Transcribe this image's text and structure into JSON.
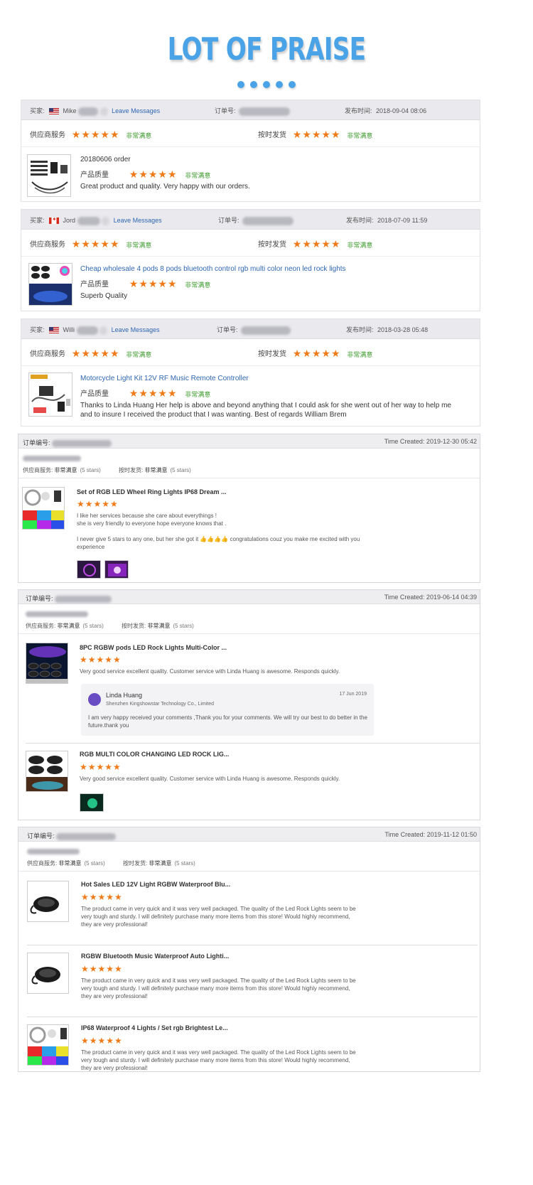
{
  "header": {
    "title": "LOT OF PRAISE",
    "dots_count": 5
  },
  "colors": {
    "accent": "#4aa3e6",
    "star": "#ef7a18",
    "satisfied": "#3c9a2c",
    "link": "#2f67b1"
  },
  "common": {
    "buyer_label": "买家:",
    "order_label": "订单号:",
    "posted_label": "发布时间:",
    "leave_messages": "Leave Messages",
    "service_label": "供应商服务",
    "delivery_label": "按时发货",
    "quality_label": "产品质量",
    "very_satisfied": "非常满意",
    "stars": "★★★★★",
    "order_no_label": "订单编号:",
    "service_label_b": "供应商服务:",
    "delivery_label_b": "按时发货:",
    "five_stars": "(5 stars)"
  },
  "reviews_a": [
    {
      "buyer": "Mike",
      "flag": "us",
      "posted": "2018-09-04 08:06",
      "product_title": "20180606 order",
      "text": "Great product and quality. Very happy with our orders."
    },
    {
      "buyer": "Jord",
      "flag": "ca",
      "posted": "2018-07-09 11:59",
      "product_title": "Cheap wholesale 4 pods 8 pods bluetooth control rgb multi color neon led rock lights",
      "text": "Superb Quality"
    },
    {
      "buyer": "Willi",
      "flag": "us",
      "posted": "2018-03-28 05:48",
      "product_title": "Motorcycle Light Kit 12V RF Music Remote Controller",
      "text": "Thanks to Linda Huang Her help is above and beyond anything that I could ask for she went out of her way to help me and to insure I received the product that I was wanting. Best of regards William Brem"
    }
  ],
  "reviews_b": [
    {
      "time_created": "Time Created: 2019-12-30 05:42",
      "items": [
        {
          "name": "Set of RGB LED Wheel Ring Lights IP68 Dream ...",
          "text1": "I like her services because she care about everythings !",
          "text2": "she is very friendly to everyone hope everyone knows that .",
          "text3": "I never give 5 stars to any one, but her she  got it 👍👍👍👍 congratulations  couz you make me excited with you experience"
        }
      ]
    },
    {
      "time_created": "Time Created: 2019-06-14 04:39",
      "items": [
        {
          "name": "8PC RGBW pods LED Rock Lights Multi-Color ...",
          "text": "Very good service excellent quality. Customer service with Linda Huang is awesome.  Responds quickly.",
          "reply": {
            "name": "Linda Huang",
            "company": "Shenzhen Kingshowstar Technology Co., Limited",
            "date": "17 Jun 2019",
            "text": "I am very happy received your comments ,Thank you for your comments. We will try our best to do better in the future.thank you"
          }
        },
        {
          "name": "RGB MULTI COLOR CHANGING LED ROCK LIG...",
          "text": "Very good service excellent quality. Customer service with Linda Huang is awesome.  Responds quickly."
        }
      ]
    },
    {
      "time_created": "Time Created: 2019-11-12 01:50",
      "items": [
        {
          "name": "Hot Sales LED 12V Light RGBW Waterproof Blu...",
          "text": "The product came in very quick and it was very well packaged. The quality of the Led Rock Lights seem to be very tough and sturdy. I will definitely purchase many more items from this store! Would highly recommend, they are very professional!"
        },
        {
          "name": "RGBW Bluetooth Music Waterproof Auto Lighti...",
          "text": "The product came in very quick and it was very well packaged. The quality of the Led Rock Lights seem to be very tough and sturdy. I will definitely purchase many more items from this store! Would highly recommend, they are very professional!"
        },
        {
          "name": "IP68 Waterproof 4 Lights / Set rgb Brightest Le...",
          "text": "The product came in very quick and it was very well packaged. The quality of the Led Rock Lights seem to be very tough and sturdy. I will definitely purchase many more items from this store! Would highly recommend, they are very professional!"
        }
      ]
    }
  ]
}
